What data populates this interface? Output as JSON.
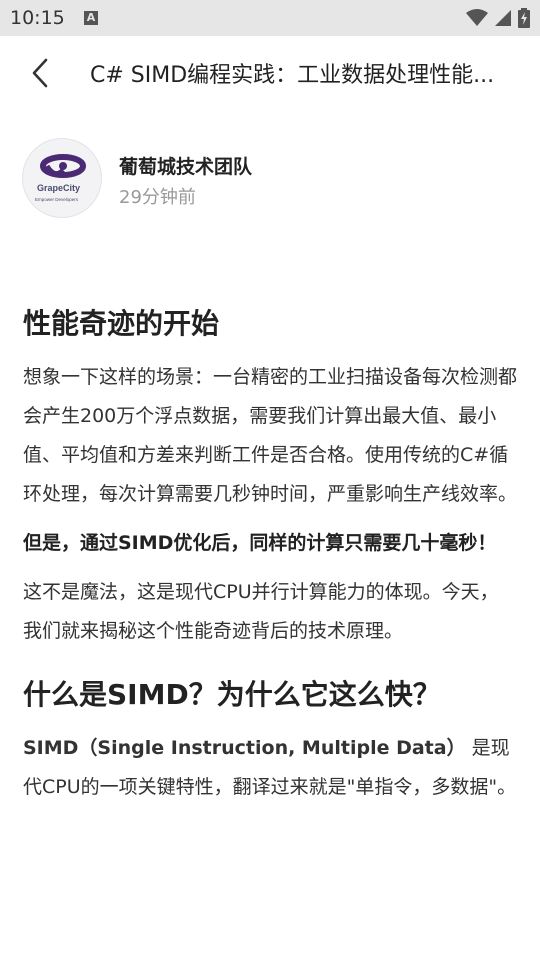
{
  "status_bar": {
    "time": "10:15",
    "notification_letter": "A"
  },
  "header": {
    "title": "C# SIMD编程实践：工业数据处理性能..."
  },
  "author": {
    "name": "葡萄城技术团队",
    "time": "29分钟前",
    "logo_brand": "GrapeCity",
    "logo_tagline": "Empower Developers"
  },
  "article": {
    "section1_heading": "性能奇迹的开始",
    "section1_p1": "想象一下这样的场景：一台精密的工业扫描设备每次检测都会产生200万个浮点数据，需要我们计算出最大值、最小值、平均值和方差来判断工件是否合格。使用传统的C#循环处理，每次计算需要几秒钟时间，严重影响生产线效率。",
    "section1_p2": "但是，通过SIMD优化后，同样的计算只需要几十毫秒！",
    "section1_p3": "这不是魔法，这是现代CPU并行计算能力的体现。今天，我们就来揭秘这个性能奇迹背后的技术原理。",
    "section2_heading": "什么是SIMD？为什么它这么快？",
    "section2_p1_bold": "SIMD（Single Instruction, Multiple Data）",
    "section2_p1_rest": " 是现代CPU的一项关键特性，翻译过来就是\"单指令，多数据\"。"
  }
}
